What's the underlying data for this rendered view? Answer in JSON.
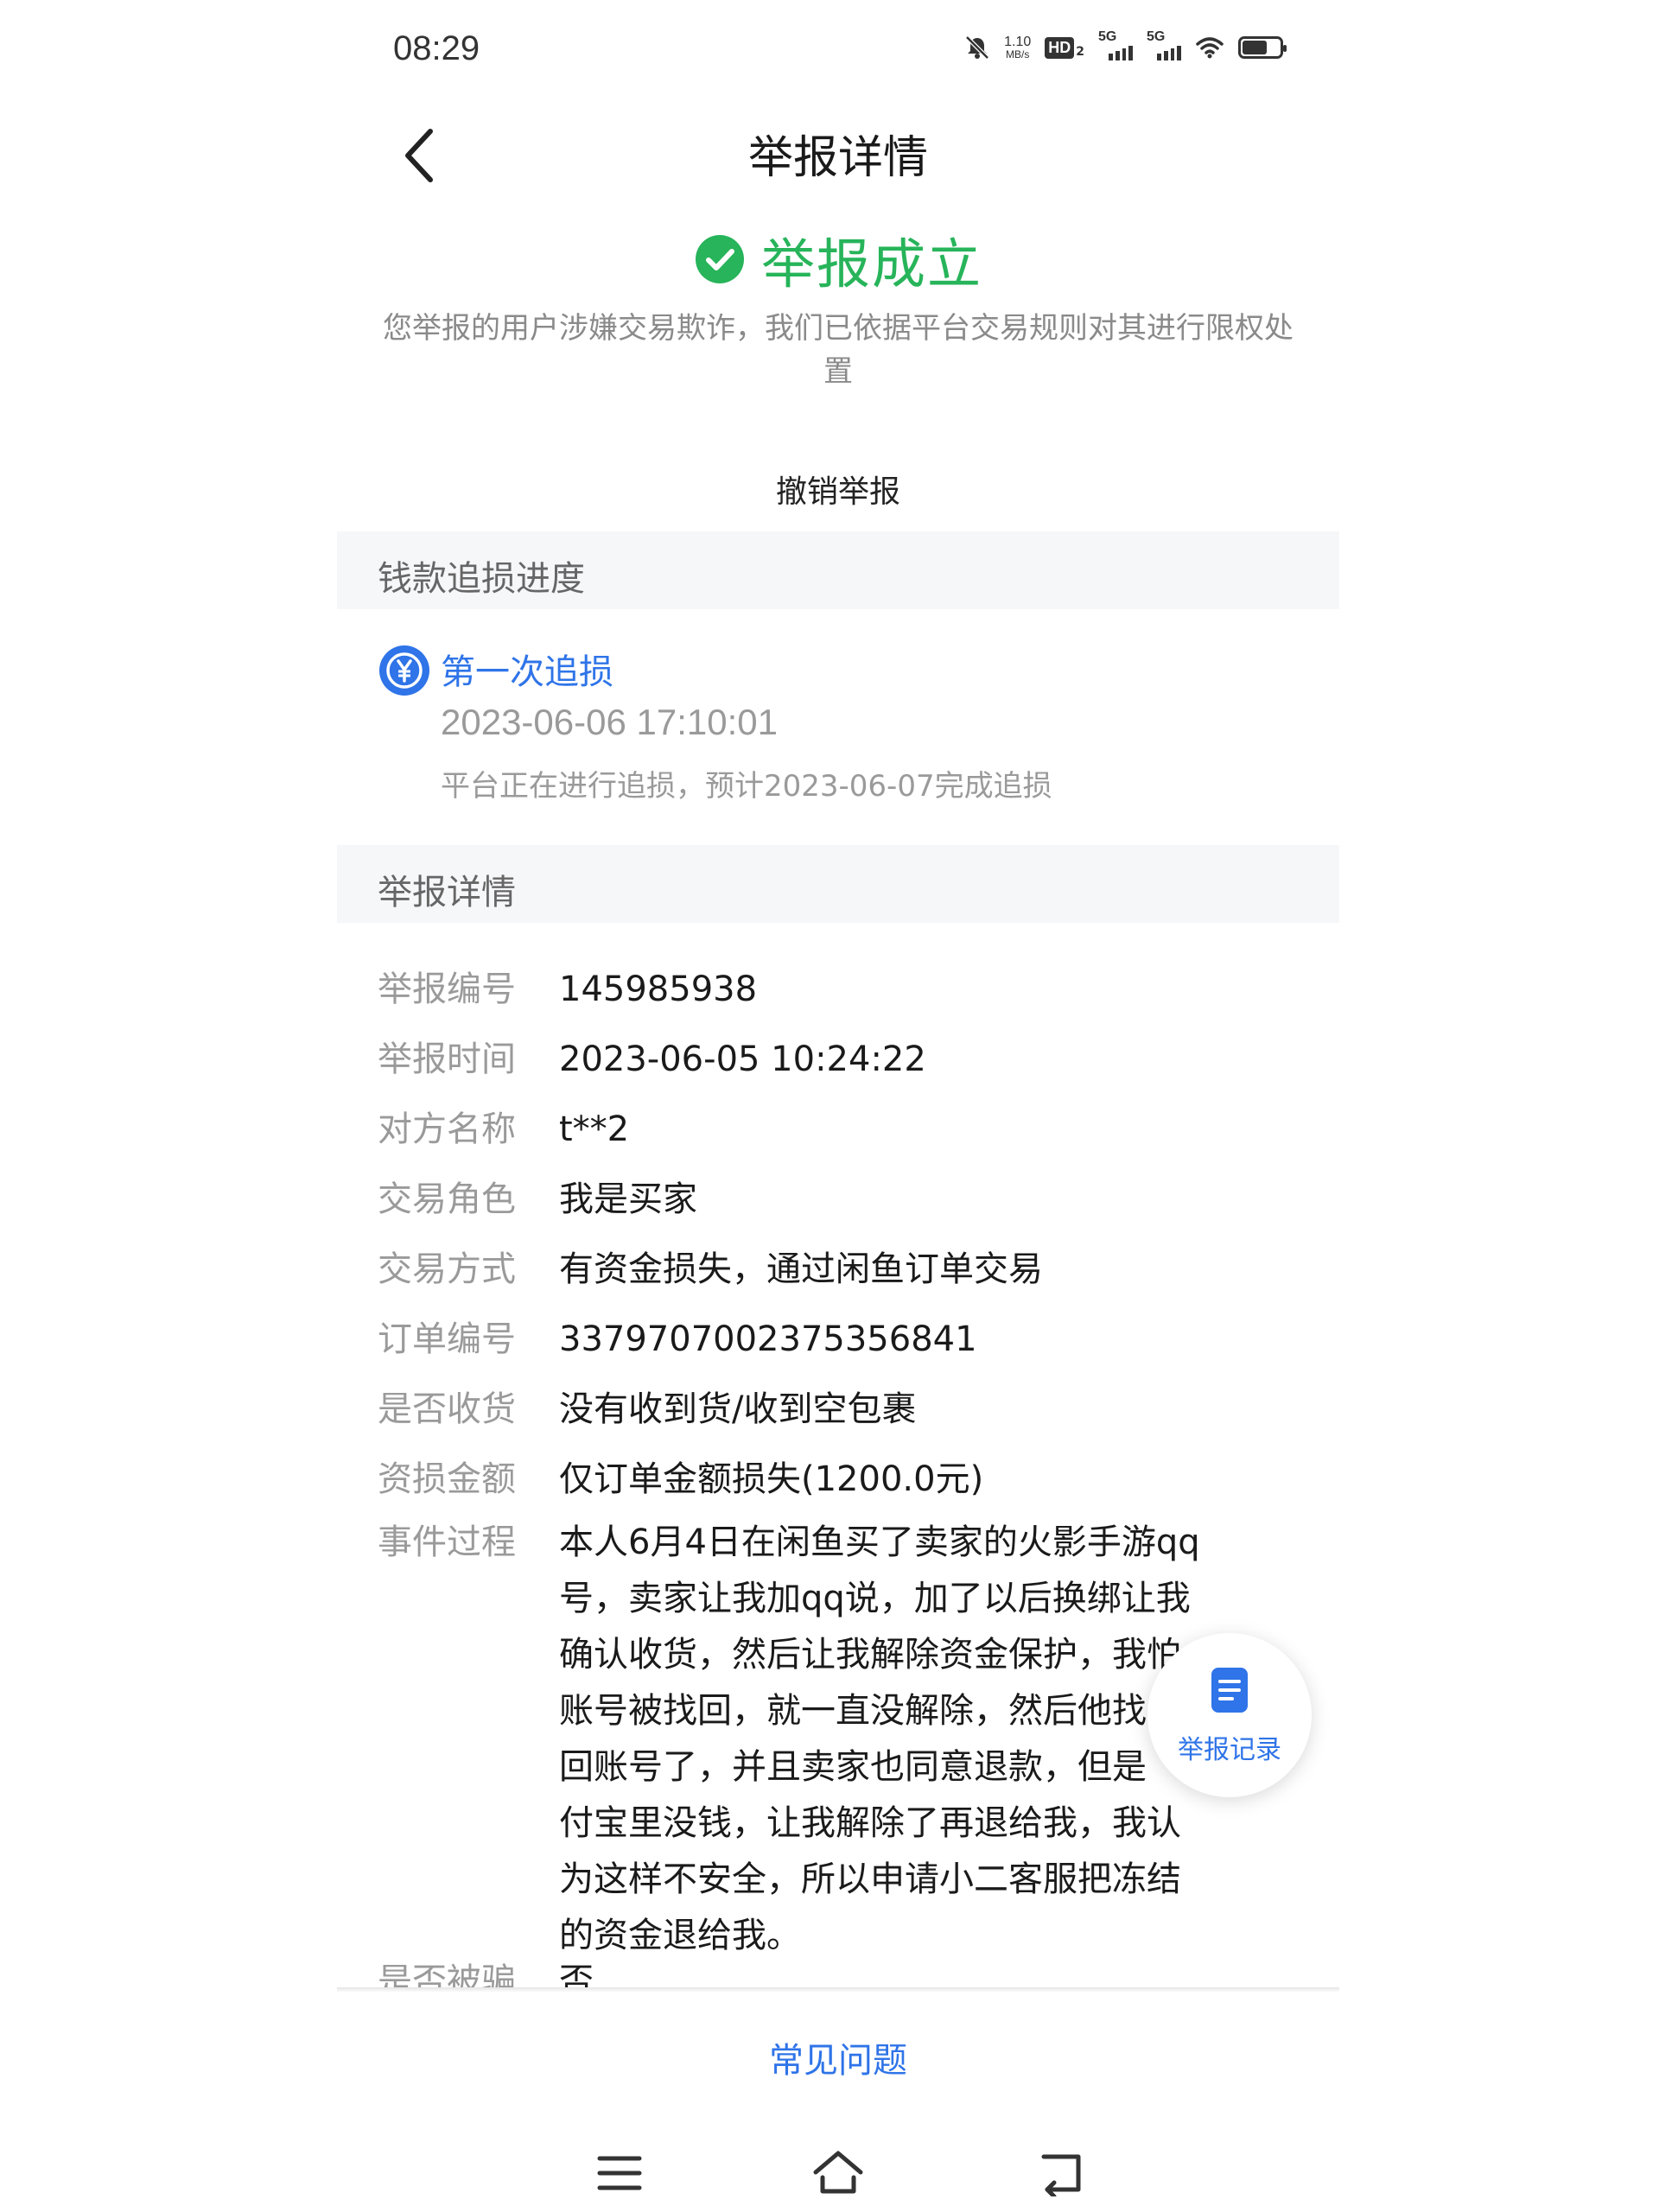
{
  "status_bar": {
    "time": "08:29",
    "net_speed_value": "1.10",
    "net_speed_unit": "MB/s",
    "hd_label": "HD",
    "hd_sub": "2",
    "sim1_label": "5G",
    "sim2_label": "5G",
    "icons": [
      "mute-icon",
      "wifi-icon",
      "battery-icon"
    ]
  },
  "header": {
    "title": "举报详情",
    "back_icon": "chevron-left-icon"
  },
  "result": {
    "title": "举报成立",
    "description": "您举报的用户涉嫌交易欺诈，我们已依据平台交易规则对其进行限权处置",
    "status_color": "#27b45a"
  },
  "cancel_report_label": "撤销举报",
  "recovery": {
    "section_title": "钱款追损进度",
    "step_title": "第一次追损",
    "step_time": "2023-06-06 17:10:01",
    "step_note": "平台正在进行追损，预计2023-06-07完成追损",
    "icon": "yuan-refund-icon"
  },
  "details": {
    "section_title": "举报详情",
    "rows": [
      {
        "label": "举报编号",
        "value": "145985938"
      },
      {
        "label": "举报时间",
        "value": "2023-06-05 10:24:22"
      },
      {
        "label": "对方名称",
        "value": "t**2"
      },
      {
        "label": "交易角色",
        "value": "我是买家"
      },
      {
        "label": "交易方式",
        "value": "有资金损失，通过闲鱼订单交易"
      },
      {
        "label": "订单编号",
        "value": "3379707002375356841"
      },
      {
        "label": "是否收货",
        "value": "没有收到货/收到空包裹"
      },
      {
        "label": "资损金额",
        "value": "仅订单金额损失(1200.0元)"
      }
    ],
    "process_label": "事件过程",
    "process_lines": [
      "本人6月4日在闲鱼买了卖家的火影手游qq",
      "号，卖家让我加qq说，加了以后换绑让我",
      "确认收货，然后让我解除资金保护，我怕",
      "账号被找回，就一直没解除，然后他找",
      "回账号了，并且卖家也同意退款，但是",
      "付宝里没钱，让我解除了再退给我，我认",
      "为这样不安全，所以申请小二客服把冻结",
      "的资金退给我。"
    ],
    "partial_row": {
      "label": "是否被骗",
      "value": "否"
    }
  },
  "fab": {
    "label": "举报记录",
    "icon": "document-icon"
  },
  "faq_label": "常见问题",
  "accent_color": "#2f74e8",
  "system_nav": [
    "menu-icon",
    "home-icon",
    "back-nav-icon"
  ]
}
